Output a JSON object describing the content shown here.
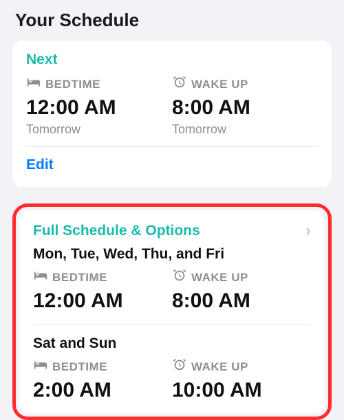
{
  "page_title": "Your Schedule",
  "next_card": {
    "heading": "Next",
    "bedtime": {
      "label": "BEDTIME",
      "time": "12:00 AM",
      "day": "Tomorrow"
    },
    "wakeup": {
      "label": "WAKE UP",
      "time": "8:00 AM",
      "day": "Tomorrow"
    },
    "edit_label": "Edit"
  },
  "full_card": {
    "heading": "Full Schedule & Options",
    "schedules": [
      {
        "days": "Mon, Tue, Wed, Thu, and Fri",
        "bedtime": {
          "label": "BEDTIME",
          "time": "12:00 AM"
        },
        "wakeup": {
          "label": "WAKE UP",
          "time": "8:00 AM"
        }
      },
      {
        "days": "Sat and Sun",
        "bedtime": {
          "label": "BEDTIME",
          "time": "2:00 AM"
        },
        "wakeup": {
          "label": "WAKE UP",
          "time": "10:00 AM"
        }
      }
    ]
  }
}
